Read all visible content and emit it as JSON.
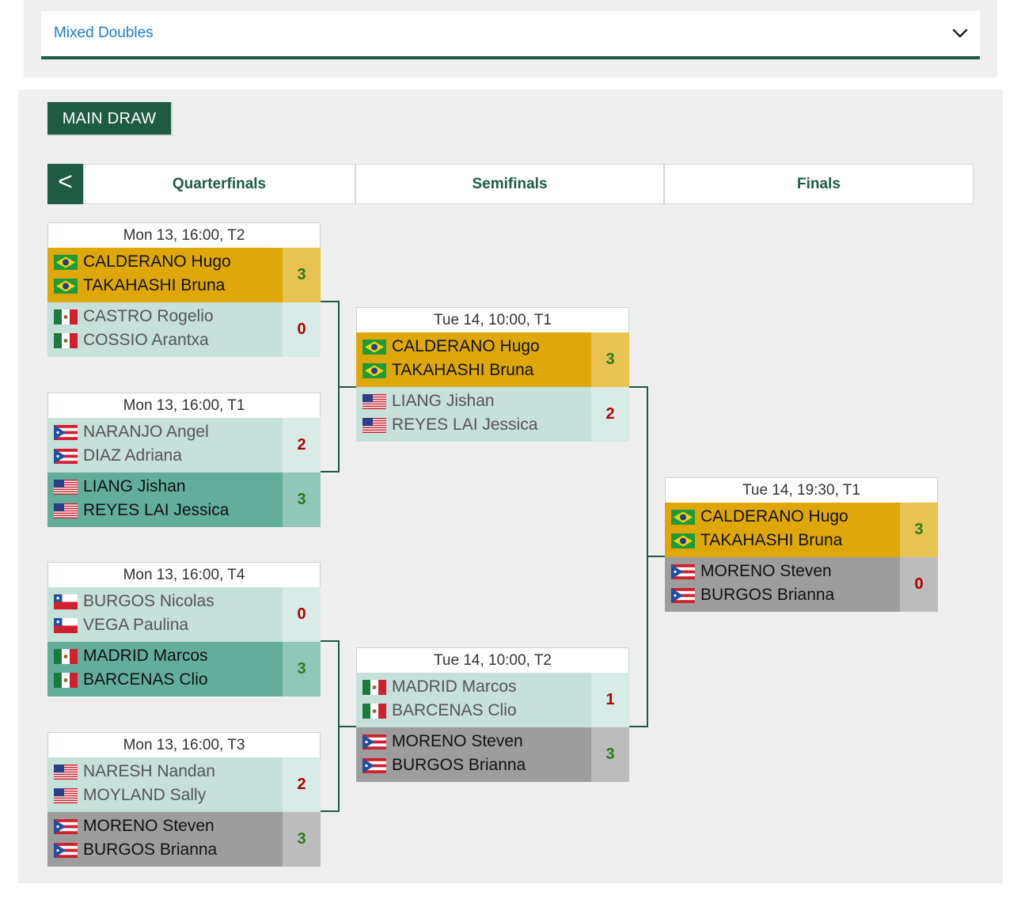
{
  "event_select": {
    "value": "Mixed Doubles",
    "icon": "chevron-down-icon"
  },
  "main_tab": "MAIN DRAW",
  "rounds": {
    "back": "<",
    "labels": [
      "Quarterfinals",
      "Semifinals",
      "Finals"
    ]
  },
  "colors": {
    "brand": "#1e5a44",
    "winner_gold": "#dea70a",
    "teal": "#62ae9b",
    "grey": "#9d9d9d",
    "light": "#c6e0da",
    "win_score": "#2b7a1a",
    "lose_score": "#b00000"
  },
  "matches": {
    "qf1": {
      "header": "Mon 13, 16:00, T2",
      "t1": {
        "p1": "CALDERANO Hugo",
        "p2": "TAKAHASHI Bruna",
        "f1": "brazil-flag-icon",
        "f2": "brazil-flag-icon",
        "score": "3"
      },
      "t2": {
        "p1": "CASTRO Rogelio",
        "p2": "COSSIO Arantxa",
        "f1": "mexico-flag-icon",
        "f2": "mexico-flag-icon",
        "score": "0"
      }
    },
    "qf2": {
      "header": "Mon 13, 16:00, T1",
      "t1": {
        "p1": "NARANJO Angel",
        "p2": "DIAZ Adriana",
        "f1": "puerto-rico-flag-icon",
        "f2": "puerto-rico-flag-icon",
        "score": "2"
      },
      "t2": {
        "p1": "LIANG Jishan",
        "p2": "REYES LAI Jessica",
        "f1": "usa-flag-icon",
        "f2": "usa-flag-icon",
        "score": "3"
      }
    },
    "qf3": {
      "header": "Mon 13, 16:00, T4",
      "t1": {
        "p1": "BURGOS Nicolas",
        "p2": "VEGA Paulina",
        "f1": "chile-flag-icon",
        "f2": "chile-flag-icon",
        "score": "0"
      },
      "t2": {
        "p1": "MADRID Marcos",
        "p2": "BARCENAS Clio",
        "f1": "mexico-flag-icon",
        "f2": "mexico-flag-icon",
        "score": "3"
      }
    },
    "qf4": {
      "header": "Mon 13, 16:00, T3",
      "t1": {
        "p1": "NARESH Nandan",
        "p2": "MOYLAND Sally",
        "f1": "usa-flag-icon",
        "f2": "usa-flag-icon",
        "score": "2"
      },
      "t2": {
        "p1": "MORENO Steven",
        "p2": "BURGOS Brianna",
        "f1": "puerto-rico-flag-icon",
        "f2": "puerto-rico-flag-icon",
        "score": "3"
      }
    },
    "sf1": {
      "header": "Tue 14, 10:00, T1",
      "t1": {
        "p1": "CALDERANO Hugo",
        "p2": "TAKAHASHI Bruna",
        "f1": "brazil-flag-icon",
        "f2": "brazil-flag-icon",
        "score": "3"
      },
      "t2": {
        "p1": "LIANG Jishan",
        "p2": "REYES LAI Jessica",
        "f1": "usa-flag-icon",
        "f2": "usa-flag-icon",
        "score": "2"
      }
    },
    "sf2": {
      "header": "Tue 14, 10:00, T2",
      "t1": {
        "p1": "MADRID Marcos",
        "p2": "BARCENAS Clio",
        "f1": "mexico-flag-icon",
        "f2": "mexico-flag-icon",
        "score": "1"
      },
      "t2": {
        "p1": "MORENO Steven",
        "p2": "BURGOS Brianna",
        "f1": "puerto-rico-flag-icon",
        "f2": "puerto-rico-flag-icon",
        "score": "3"
      }
    },
    "f": {
      "header": "Tue 14, 19:30, T1",
      "t1": {
        "p1": "CALDERANO Hugo",
        "p2": "TAKAHASHI Bruna",
        "f1": "brazil-flag-icon",
        "f2": "brazil-flag-icon",
        "score": "3"
      },
      "t2": {
        "p1": "MORENO Steven",
        "p2": "BURGOS Brianna",
        "f1": "puerto-rico-flag-icon",
        "f2": "puerto-rico-flag-icon",
        "score": "0"
      }
    }
  }
}
